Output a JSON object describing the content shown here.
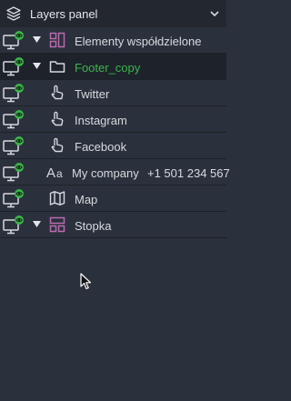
{
  "header": {
    "title": "Layers panel"
  },
  "rows": [
    {
      "label": "Elementy współdzielone",
      "icon": "shared-components-icon",
      "expanded": true
    },
    {
      "label": "Footer_copy",
      "icon": "folder-icon",
      "expanded": true,
      "selected": true
    },
    {
      "label": "Twitter",
      "icon": "hand-pointer-icon"
    },
    {
      "label": "Instagram",
      "icon": "hand-pointer-icon"
    },
    {
      "label": "Facebook",
      "icon": "hand-pointer-icon"
    },
    {
      "label": "My company",
      "extra": "+1 501 234 567",
      "icon": "text-icon"
    },
    {
      "label": "Map",
      "icon": "map-icon"
    },
    {
      "label": "Stopka",
      "icon": "components-icon",
      "expanded": true
    }
  ],
  "colors": {
    "background": "#2b313c",
    "header_background": "#23272f",
    "selected_row": "#1e232b",
    "accent_green": "#3bb44a",
    "component_pink": "#b86bb0"
  }
}
